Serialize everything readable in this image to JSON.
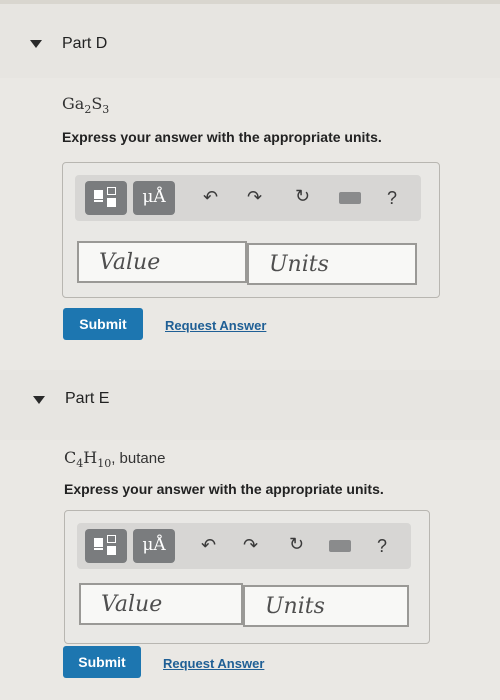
{
  "parts": [
    {
      "title": "Part D",
      "formula": {
        "el1": "Ga",
        "n1": "2",
        "el2": "S",
        "n2": "3",
        "suffix": ""
      },
      "prompt": "Express your answer with the appropriate units.",
      "toolbar": {
        "units_label": "μÅ",
        "help": "?"
      },
      "value_placeholder": "Value",
      "units_placeholder": "Units",
      "submit_label": "Submit",
      "request_label": "Request Answer"
    },
    {
      "title": "Part E",
      "formula": {
        "el1": "C",
        "n1": "4",
        "el2": "H",
        "n2": "10",
        "suffix": ", butane"
      },
      "prompt": "Express your answer with the appropriate units.",
      "toolbar": {
        "units_label": "μÅ",
        "help": "?"
      },
      "value_placeholder": "Value",
      "units_placeholder": "Units",
      "submit_label": "Submit",
      "request_label": "Request Answer"
    }
  ],
  "colors": {
    "accent": "#1d76b0",
    "link": "#1f5f95",
    "icon_button": "#7a7c7e"
  },
  "icons": [
    "collapse-triangle-icon",
    "templates-icon",
    "units-icon",
    "undo-icon",
    "redo-icon",
    "reset-icon",
    "keyboard-icon",
    "help-icon"
  ]
}
